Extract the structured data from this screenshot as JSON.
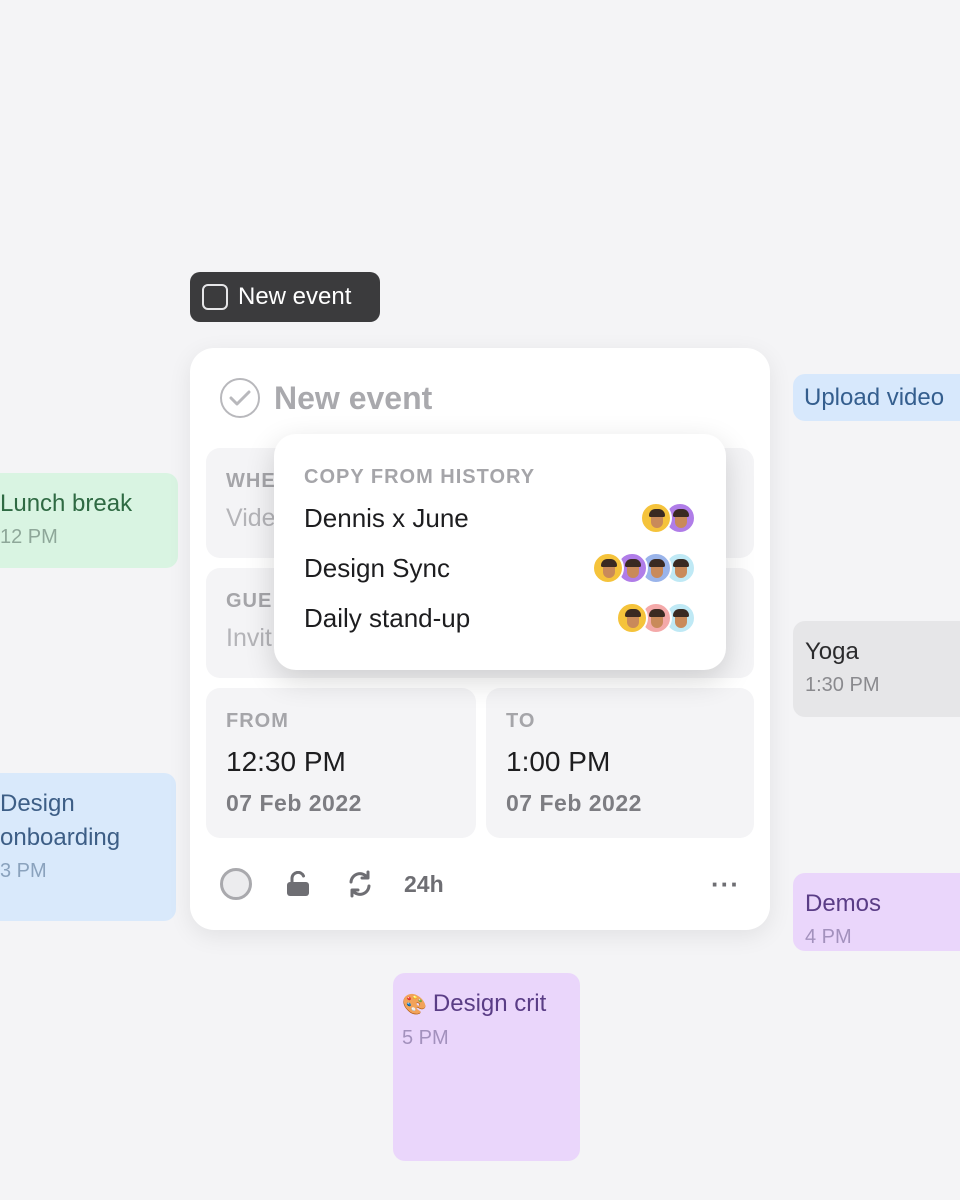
{
  "background_events": {
    "lunch": {
      "title": "Lunch break",
      "time": "12 PM",
      "color": "#d9f4e2"
    },
    "design_onboarding": {
      "title_line1": "Design",
      "title_line2": "onboarding",
      "time": "3 PM",
      "color": "#d9e9fb"
    },
    "upload": {
      "title": "Upload video",
      "color": "#d7e8fc"
    },
    "yoga": {
      "title": "Yoga",
      "time": "1:30 PM",
      "color": "#e6e6e8"
    },
    "demos": {
      "title": "Demos",
      "time": "4 PM",
      "color": "#ead6fb"
    },
    "design_crit": {
      "emoji": "🎨",
      "title": "Design crit",
      "time": "5 PM",
      "color": "#ead6fb"
    }
  },
  "tooltip": {
    "label": "New event"
  },
  "card": {
    "title": "New event",
    "where": {
      "caption": "WHE",
      "placeholder": "Vide"
    },
    "guests": {
      "caption": "GUE",
      "placeholder": "Invit"
    },
    "from": {
      "caption": "FROM",
      "time": "12:30 PM",
      "date": "07 Feb 2022"
    },
    "to": {
      "caption": "TO",
      "time": "1:00 PM",
      "date": "07 Feb 2022"
    },
    "toolbar": {
      "duration": "24h",
      "more": "···",
      "icons": [
        "status-circle-icon",
        "unlock-icon",
        "repeat-icon"
      ]
    }
  },
  "history": {
    "caption": "COPY FROM HISTORY",
    "items": [
      {
        "name": "Dennis x June",
        "avatar_colors": [
          "#f5c33b",
          "#b07de8"
        ]
      },
      {
        "name": "Design Sync",
        "avatar_colors": [
          "#f5c33b",
          "#b07de8",
          "#9ab4ea",
          "#bfe9f5"
        ]
      },
      {
        "name": "Daily stand-up",
        "avatar_colors": [
          "#f5c33b",
          "#f4a9a9",
          "#bfe9f5"
        ]
      }
    ]
  }
}
